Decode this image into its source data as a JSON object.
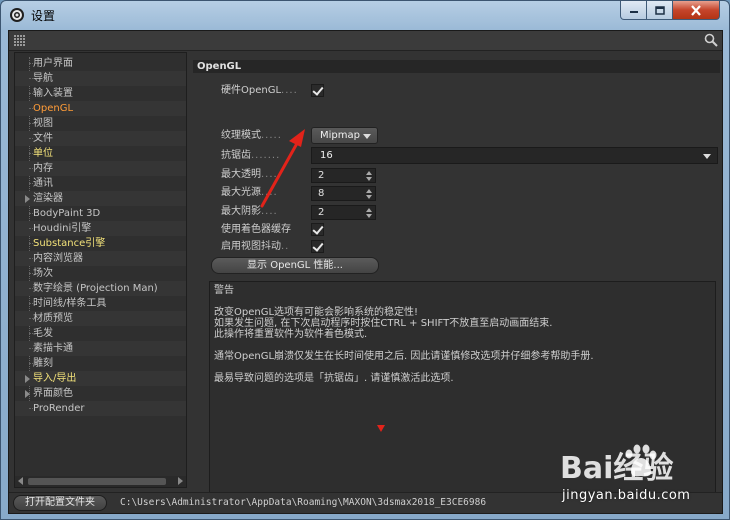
{
  "window": {
    "title": "设置"
  },
  "sidebar": {
    "items": [
      {
        "label": "用户界面"
      },
      {
        "label": "导航"
      },
      {
        "label": "输入装置"
      },
      {
        "label": "OpenGL"
      },
      {
        "label": "视图"
      },
      {
        "label": "文件"
      },
      {
        "label": "单位"
      },
      {
        "label": "内存"
      },
      {
        "label": "通讯"
      },
      {
        "label": "渲染器"
      },
      {
        "label": "BodyPaint 3D"
      },
      {
        "label": "Houdini引擎"
      },
      {
        "label": "Substance引擎"
      },
      {
        "label": "内容浏览器"
      },
      {
        "label": "场次"
      },
      {
        "label": "数字绘景 (Projection Man)"
      },
      {
        "label": "时间线/样条工具"
      },
      {
        "label": "材质预览"
      },
      {
        "label": "毛发"
      },
      {
        "label": "素描卡通"
      },
      {
        "label": "雕刻"
      },
      {
        "label": "导入/导出"
      },
      {
        "label": "界面颜色"
      },
      {
        "label": "ProRender"
      }
    ]
  },
  "section": {
    "title": "OpenGL"
  },
  "settings": {
    "hardware_opengl": {
      "label": "硬件OpenGL",
      "dots": "...."
    },
    "texture_mode": {
      "label": "纹理模式",
      "dots": ".....",
      "value": "Mipmap"
    },
    "antialias": {
      "label": "抗锯齿",
      "dots": ".......",
      "value": "16"
    },
    "max_transparency": {
      "label": "最大透明",
      "dots": "....",
      "value": "2"
    },
    "max_lights": {
      "label": "最大光源",
      "dots": "....",
      "value": "8"
    },
    "max_shadows": {
      "label": "最大阴影",
      "dots": "....",
      "value": "2"
    },
    "shader_cache": {
      "label": "使用着色器缓存"
    },
    "viewport_jitter": {
      "label": "启用视图抖动",
      "dots": ".."
    },
    "show_opengl_button": "显示 OpenGL 性能..."
  },
  "warning": {
    "title": "警告",
    "lines": [
      "改变OpenGL选项有可能会影响系统的稳定性!",
      "如果发生问题, 在下次启动程序时按住CTRL + SHIFT不放直至启动画面结束.",
      "此操作将重置软件为软件着色模式.",
      "通常OpenGL崩溃仅发生在长时间使用之后. 因此请谨慎修改选项并仔细参考帮助手册.",
      "最易导致问题的选项是「抗锯齿」. 请谨慎激活此选项."
    ]
  },
  "footer": {
    "open_folder_button": "打开配置文件夹",
    "path": "C:\\Users\\Administrator\\AppData\\Roaming\\MAXON\\3dsmax2018_E3CE6986"
  },
  "watermark": {
    "text": "jingyan.baidu.com",
    "brand": "Bai经验"
  },
  "colors": {
    "accent_active": "#ff9c38",
    "accent_highlight": "#f3e27a",
    "annotation_arrow": "#e2231a"
  }
}
